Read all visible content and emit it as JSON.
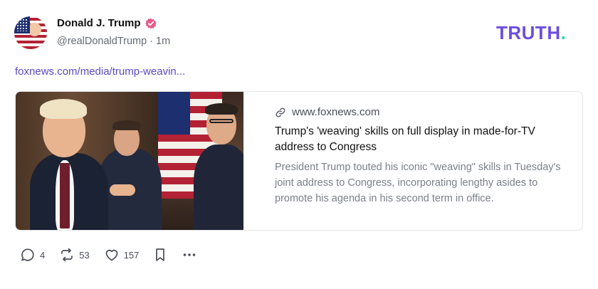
{
  "post": {
    "author_name": "Donald J. Trump",
    "handle": "@realDonaldTrump",
    "separator": "·",
    "time_ago": "1m",
    "link_text": "foxnews.com/media/trump-weavin...",
    "verified_color": "#e85b8b"
  },
  "brand": {
    "text": "TRUTH",
    "dot": ".",
    "primary_color": "#6b4ee0",
    "accent_color": "#28d7c0"
  },
  "card": {
    "domain": "www.foxnews.com",
    "title": "Trump's 'weaving' skills on full display in made-for-TV address to Congress",
    "description": "President Trump touted his iconic \"weaving\" skills in Tuesday's joint address to Congress, incorporating lengthy asides to promote his agenda in his second term in office.",
    "image": "photo-of-speaker-at-joint-address"
  },
  "actions": {
    "replies": "4",
    "retruths": "53",
    "likes": "157",
    "icons": [
      "reply-icon",
      "retruth-icon",
      "heart-icon",
      "bookmark-icon",
      "more-icon"
    ]
  }
}
